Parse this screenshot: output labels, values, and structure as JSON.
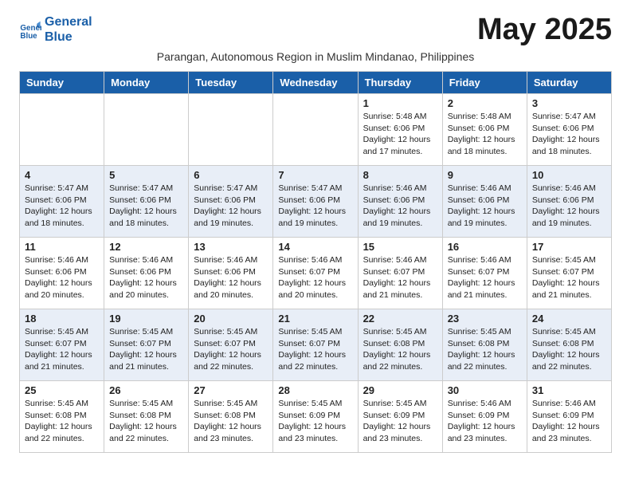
{
  "header": {
    "logo_line1": "General",
    "logo_line2": "Blue",
    "month_title": "May 2025",
    "subtitle": "Parangan, Autonomous Region in Muslim Mindanao, Philippines"
  },
  "days_of_week": [
    "Sunday",
    "Monday",
    "Tuesday",
    "Wednesday",
    "Thursday",
    "Friday",
    "Saturday"
  ],
  "weeks": [
    [
      {
        "day": "",
        "info": ""
      },
      {
        "day": "",
        "info": ""
      },
      {
        "day": "",
        "info": ""
      },
      {
        "day": "",
        "info": ""
      },
      {
        "day": "1",
        "info": "Sunrise: 5:48 AM\nSunset: 6:06 PM\nDaylight: 12 hours\nand 17 minutes."
      },
      {
        "day": "2",
        "info": "Sunrise: 5:48 AM\nSunset: 6:06 PM\nDaylight: 12 hours\nand 18 minutes."
      },
      {
        "day": "3",
        "info": "Sunrise: 5:47 AM\nSunset: 6:06 PM\nDaylight: 12 hours\nand 18 minutes."
      }
    ],
    [
      {
        "day": "4",
        "info": "Sunrise: 5:47 AM\nSunset: 6:06 PM\nDaylight: 12 hours\nand 18 minutes."
      },
      {
        "day": "5",
        "info": "Sunrise: 5:47 AM\nSunset: 6:06 PM\nDaylight: 12 hours\nand 18 minutes."
      },
      {
        "day": "6",
        "info": "Sunrise: 5:47 AM\nSunset: 6:06 PM\nDaylight: 12 hours\nand 19 minutes."
      },
      {
        "day": "7",
        "info": "Sunrise: 5:47 AM\nSunset: 6:06 PM\nDaylight: 12 hours\nand 19 minutes."
      },
      {
        "day": "8",
        "info": "Sunrise: 5:46 AM\nSunset: 6:06 PM\nDaylight: 12 hours\nand 19 minutes."
      },
      {
        "day": "9",
        "info": "Sunrise: 5:46 AM\nSunset: 6:06 PM\nDaylight: 12 hours\nand 19 minutes."
      },
      {
        "day": "10",
        "info": "Sunrise: 5:46 AM\nSunset: 6:06 PM\nDaylight: 12 hours\nand 19 minutes."
      }
    ],
    [
      {
        "day": "11",
        "info": "Sunrise: 5:46 AM\nSunset: 6:06 PM\nDaylight: 12 hours\nand 20 minutes."
      },
      {
        "day": "12",
        "info": "Sunrise: 5:46 AM\nSunset: 6:06 PM\nDaylight: 12 hours\nand 20 minutes."
      },
      {
        "day": "13",
        "info": "Sunrise: 5:46 AM\nSunset: 6:06 PM\nDaylight: 12 hours\nand 20 minutes."
      },
      {
        "day": "14",
        "info": "Sunrise: 5:46 AM\nSunset: 6:07 PM\nDaylight: 12 hours\nand 20 minutes."
      },
      {
        "day": "15",
        "info": "Sunrise: 5:46 AM\nSunset: 6:07 PM\nDaylight: 12 hours\nand 21 minutes."
      },
      {
        "day": "16",
        "info": "Sunrise: 5:46 AM\nSunset: 6:07 PM\nDaylight: 12 hours\nand 21 minutes."
      },
      {
        "day": "17",
        "info": "Sunrise: 5:45 AM\nSunset: 6:07 PM\nDaylight: 12 hours\nand 21 minutes."
      }
    ],
    [
      {
        "day": "18",
        "info": "Sunrise: 5:45 AM\nSunset: 6:07 PM\nDaylight: 12 hours\nand 21 minutes."
      },
      {
        "day": "19",
        "info": "Sunrise: 5:45 AM\nSunset: 6:07 PM\nDaylight: 12 hours\nand 21 minutes."
      },
      {
        "day": "20",
        "info": "Sunrise: 5:45 AM\nSunset: 6:07 PM\nDaylight: 12 hours\nand 22 minutes."
      },
      {
        "day": "21",
        "info": "Sunrise: 5:45 AM\nSunset: 6:07 PM\nDaylight: 12 hours\nand 22 minutes."
      },
      {
        "day": "22",
        "info": "Sunrise: 5:45 AM\nSunset: 6:08 PM\nDaylight: 12 hours\nand 22 minutes."
      },
      {
        "day": "23",
        "info": "Sunrise: 5:45 AM\nSunset: 6:08 PM\nDaylight: 12 hours\nand 22 minutes."
      },
      {
        "day": "24",
        "info": "Sunrise: 5:45 AM\nSunset: 6:08 PM\nDaylight: 12 hours\nand 22 minutes."
      }
    ],
    [
      {
        "day": "25",
        "info": "Sunrise: 5:45 AM\nSunset: 6:08 PM\nDaylight: 12 hours\nand 22 minutes."
      },
      {
        "day": "26",
        "info": "Sunrise: 5:45 AM\nSunset: 6:08 PM\nDaylight: 12 hours\nand 22 minutes."
      },
      {
        "day": "27",
        "info": "Sunrise: 5:45 AM\nSunset: 6:08 PM\nDaylight: 12 hours\nand 23 minutes."
      },
      {
        "day": "28",
        "info": "Sunrise: 5:45 AM\nSunset: 6:09 PM\nDaylight: 12 hours\nand 23 minutes."
      },
      {
        "day": "29",
        "info": "Sunrise: 5:45 AM\nSunset: 6:09 PM\nDaylight: 12 hours\nand 23 minutes."
      },
      {
        "day": "30",
        "info": "Sunrise: 5:46 AM\nSunset: 6:09 PM\nDaylight: 12 hours\nand 23 minutes."
      },
      {
        "day": "31",
        "info": "Sunrise: 5:46 AM\nSunset: 6:09 PM\nDaylight: 12 hours\nand 23 minutes."
      }
    ]
  ],
  "colors": {
    "header_bg": "#1a5fa8",
    "logo_blue": "#1a5fa8"
  }
}
